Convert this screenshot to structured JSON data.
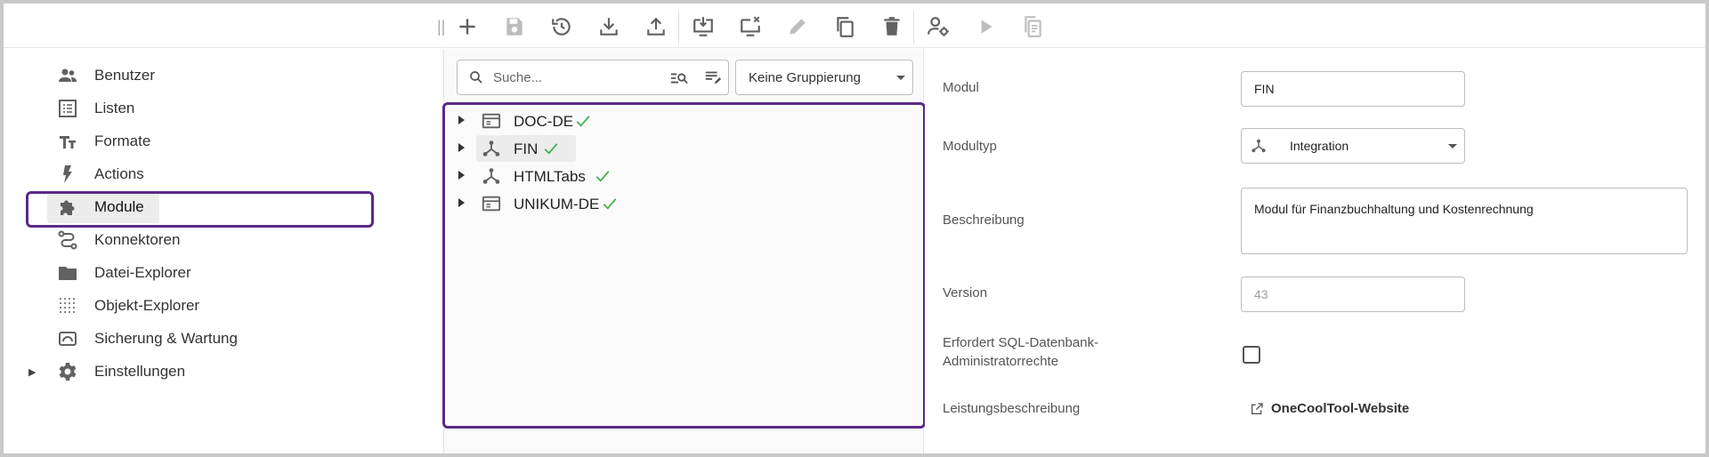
{
  "colors": {
    "accent": "#5b2a86",
    "check": "#4caf50",
    "icon": "#616161",
    "disabled": "#bdbdbd"
  },
  "toolbar": {
    "items": [
      {
        "name": "add-icon",
        "enabled": true
      },
      {
        "name": "save-icon",
        "enabled": false
      },
      {
        "name": "restore-icon",
        "enabled": true
      },
      {
        "name": "import-icon",
        "enabled": true
      },
      {
        "name": "export-icon",
        "enabled": true
      },
      {
        "name": "install-icon",
        "enabled": true
      },
      {
        "name": "uninstall-icon",
        "enabled": true
      },
      {
        "name": "edit-icon",
        "enabled": false
      },
      {
        "name": "copy-icon",
        "enabled": true
      },
      {
        "name": "delete-icon",
        "enabled": true
      },
      {
        "name": "user-settings-icon",
        "enabled": true
      },
      {
        "name": "play-icon",
        "enabled": false
      },
      {
        "name": "document-copy-icon",
        "enabled": false
      }
    ]
  },
  "sidebar": {
    "items": [
      {
        "label": "Benutzer",
        "icon": "users-icon"
      },
      {
        "label": "Listen",
        "icon": "list-icon"
      },
      {
        "label": "Formate",
        "icon": "format-icon"
      },
      {
        "label": "Actions",
        "icon": "bolt-icon"
      },
      {
        "label": "Module",
        "icon": "puzzle-icon",
        "active": true
      },
      {
        "label": "Konnektoren",
        "icon": "connector-icon"
      },
      {
        "label": "Datei-Explorer",
        "icon": "folder-icon"
      },
      {
        "label": "Objekt-Explorer",
        "icon": "grid-dots-icon"
      },
      {
        "label": "Sicherung & Wartung",
        "icon": "backup-icon"
      },
      {
        "label": "Einstellungen",
        "icon": "gear-icon",
        "expandable": true
      }
    ]
  },
  "search": {
    "placeholder": "Suche..."
  },
  "grouping": {
    "value": "Keine Gruppierung"
  },
  "tree": {
    "items": [
      {
        "label": "DOC-DE",
        "icon": "window-icon",
        "installed": true
      },
      {
        "label": "FIN",
        "icon": "integration-icon",
        "installed": true,
        "selected": true
      },
      {
        "label": "HTMLTabs",
        "icon": "integration-icon",
        "installed": true
      },
      {
        "label": "UNIKUM-DE",
        "icon": "window-icon",
        "installed": true
      }
    ]
  },
  "details": {
    "modul_label": "Modul",
    "modul_value": "FIN",
    "modultyp_label": "Modultyp",
    "modultyp_value": "Integration",
    "beschreibung_label": "Beschreibung",
    "beschreibung_value": "Modul für Finanzbuchhaltung und Kostenrechnung",
    "version_label": "Version",
    "version_value": "43",
    "sql_label_1": "Erfordert SQL-Datenbank-",
    "sql_label_2": "Administratorrechte",
    "sql_checked": false,
    "leistung_label": "Leistungsbeschreibung",
    "leistung_link": "OneCoolTool-Website"
  }
}
